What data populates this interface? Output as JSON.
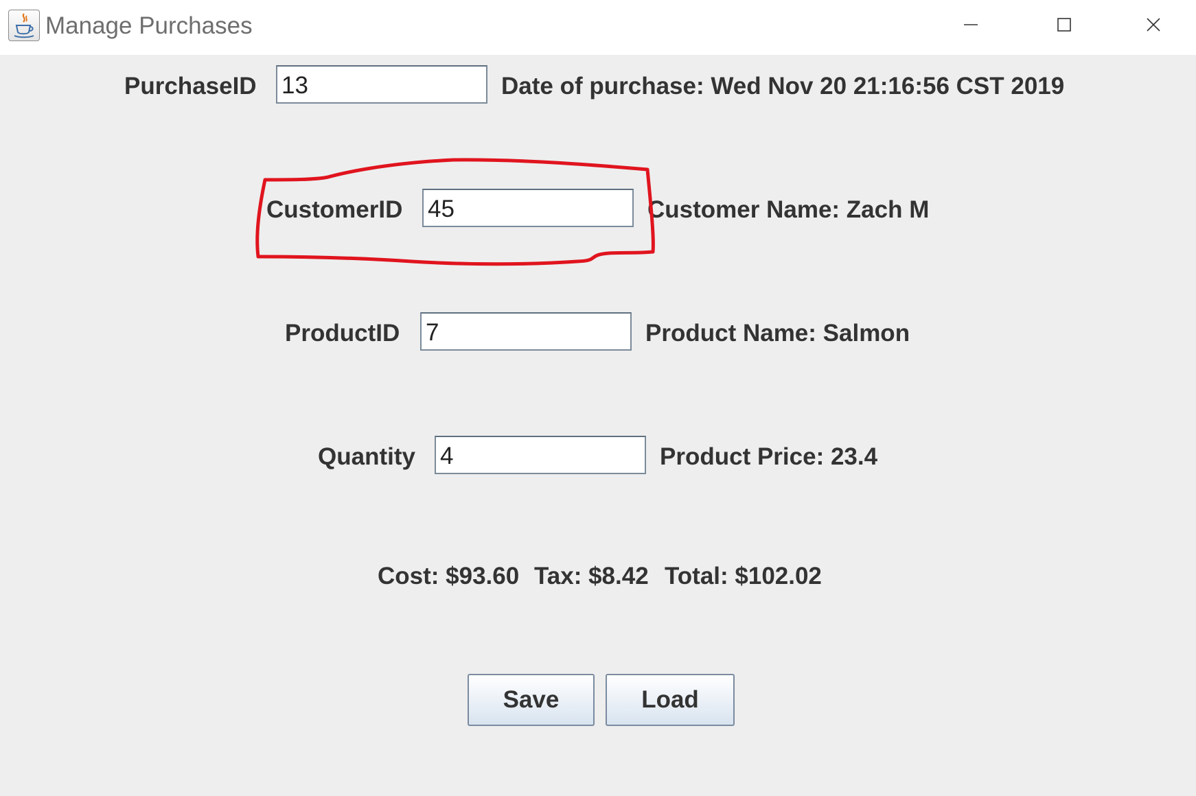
{
  "window": {
    "title": "Manage Purchases",
    "app_icon": "java-coffee-icon"
  },
  "controls": {
    "minimize_icon": "minimize-icon",
    "maximize_icon": "maximize-icon",
    "close_icon": "close-icon"
  },
  "form": {
    "purchase_id_label": "PurchaseID",
    "purchase_id_value": "13",
    "date_text": "Date of purchase: Wed Nov 20 21:16:56 CST 2019",
    "customer_id_label": "CustomerID",
    "customer_id_value": "45",
    "customer_name_text": "Customer Name: Zach M",
    "product_id_label": "ProductID",
    "product_id_value": "7",
    "product_name_text": "Product Name: Salmon",
    "quantity_label": "Quantity",
    "quantity_value": "4",
    "product_price_text": "Product Price: 23.4",
    "cost_text": "Cost: $93.60",
    "tax_text": "Tax: $8.42",
    "total_text": "Total: $102.02"
  },
  "buttons": {
    "save_label": "Save",
    "load_label": "Load"
  },
  "colors": {
    "background": "#eeeeee",
    "annotation": "#e0141e"
  }
}
